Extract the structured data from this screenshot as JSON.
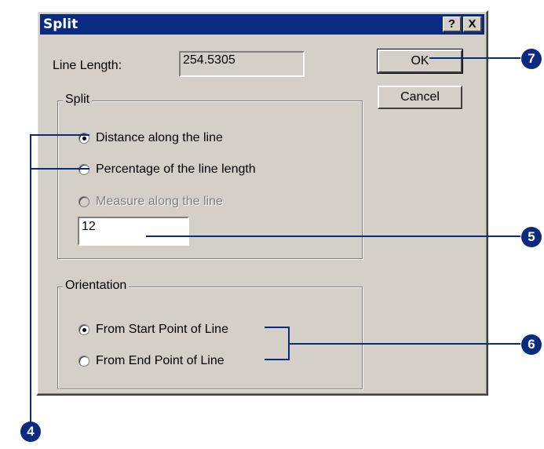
{
  "dialog": {
    "title": "Split",
    "help_button": "?",
    "close_button": "X",
    "line_length_label": "Line Length:",
    "line_length_value": "254.5305",
    "ok_button": "OK",
    "cancel_button": "Cancel",
    "split_group": {
      "title": "Split",
      "options": [
        {
          "label": "Distance along the line",
          "checked": true,
          "enabled": true
        },
        {
          "label": "Percentage of the line length",
          "checked": false,
          "enabled": true
        },
        {
          "label": "Measure along the line",
          "checked": false,
          "enabled": false
        }
      ],
      "value": "12"
    },
    "orientation_group": {
      "title": "Orientation",
      "options": [
        {
          "label": "From Start Point of Line",
          "checked": true
        },
        {
          "label": "From End Point of Line",
          "checked": false
        }
      ]
    }
  },
  "callouts": {
    "step_4": "4",
    "step_5": "5",
    "step_6": "6",
    "step_7": "7",
    "color": "#0a2a80"
  }
}
